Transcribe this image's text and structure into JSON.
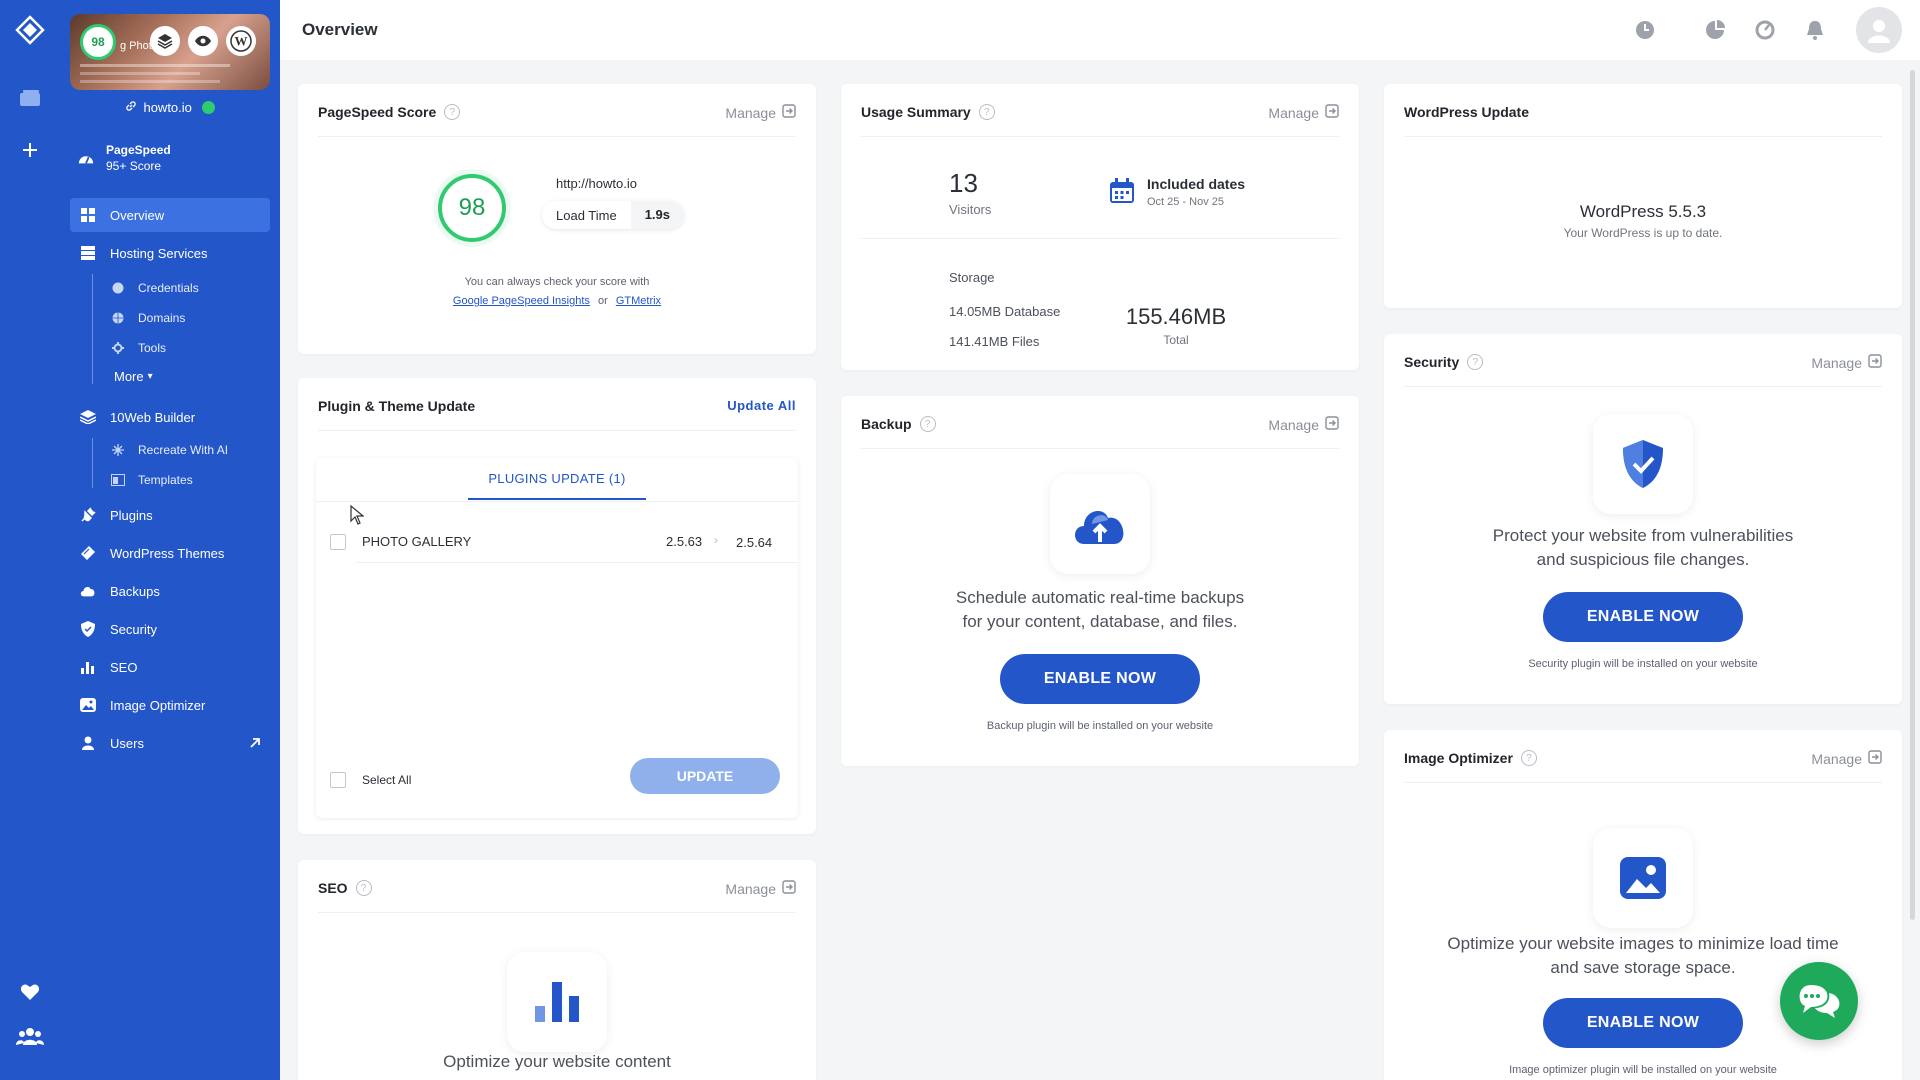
{
  "rail": {
    "icons": [
      "tenweb-logo-icon",
      "websites-icon",
      "add-icon",
      "heart-icon",
      "team-icon"
    ]
  },
  "sidebar": {
    "site_thumb_text": "g Phot",
    "site_score": "98",
    "site_link": "howto.io",
    "pagespeed_title": "PageSpeed",
    "pagespeed_sub": "95+ Score",
    "items": [
      {
        "label": "Overview",
        "icon": "grid-icon",
        "active": true
      },
      {
        "label": "Hosting Services",
        "icon": "server-icon"
      },
      {
        "label": "10Web Builder",
        "icon": "layers-icon"
      },
      {
        "label": "Plugins",
        "icon": "plug-icon"
      },
      {
        "label": "WordPress Themes",
        "icon": "brush-icon"
      },
      {
        "label": "Backups",
        "icon": "cloud-icon"
      },
      {
        "label": "Security",
        "icon": "shield-icon"
      },
      {
        "label": "SEO",
        "icon": "bar-chart-icon"
      },
      {
        "label": "Image Optimizer",
        "icon": "image-icon"
      },
      {
        "label": "Users",
        "icon": "user-icon"
      }
    ],
    "hosting_sub": [
      "Credentials",
      "Domains",
      "Tools"
    ],
    "more_label": "More",
    "builder_sub": [
      "Recreate With AI",
      "Templates"
    ]
  },
  "header": {
    "title": "Overview"
  },
  "pagespeed_card": {
    "title": "PageSpeed Score",
    "manage": "Manage",
    "score": "98",
    "url": "http://howto.io",
    "load_time_label": "Load Time",
    "load_time_value": "1.9s",
    "note": "You can always check your score with",
    "link1": "Google PageSpeed Insights",
    "or": "or",
    "link2": "GTMetrix"
  },
  "plugin_card": {
    "title": "Plugin & Theme Update",
    "update_all": "Update All",
    "tab": "PLUGINS UPDATE (1)",
    "plugin_name": "PHOTO GALLERY",
    "from_version": "2.5.63",
    "to_version": "2.5.64",
    "select_all": "Select All",
    "update_button": "UPDATE"
  },
  "seo_card": {
    "title": "SEO",
    "manage": "Manage",
    "desc": "Optimize your website content"
  },
  "usage_card": {
    "title": "Usage Summary",
    "manage": "Manage",
    "visitors_value": "13",
    "visitors_label": "Visitors",
    "dates_title": "Included dates",
    "dates_range": "Oct 25 - Nov 25",
    "storage_label": "Storage",
    "database": "14.05MB Database",
    "files": "141.41MB Files",
    "total_value": "155.46MB",
    "total_label": "Total"
  },
  "backup_card": {
    "title": "Backup",
    "manage": "Manage",
    "desc1": "Schedule automatic real-time backups",
    "desc2": "for your content, database, and files.",
    "button": "ENABLE NOW",
    "note": "Backup plugin will be installed on your website"
  },
  "wp_card": {
    "title": "WordPress Update",
    "version": "WordPress 5.5.3",
    "status": "Your WordPress is up to date."
  },
  "security_card": {
    "title": "Security",
    "manage": "Manage",
    "desc1": "Protect your website from vulnerabilities",
    "desc2": "and suspicious file changes.",
    "button": "ENABLE NOW",
    "note": "Security plugin will be installed on your website"
  },
  "image_card": {
    "title": "Image Optimizer",
    "manage": "Manage",
    "desc1": "Optimize your website images to minimize load time",
    "desc2": "and save storage space.",
    "button": "ENABLE NOW",
    "note": "Image optimizer plugin will be installed on your website"
  },
  "colors": {
    "sidebar": "#2356c8",
    "active": "#3b71e0",
    "score_green": "#2ecc71",
    "chat_green": "#1faa5b"
  }
}
